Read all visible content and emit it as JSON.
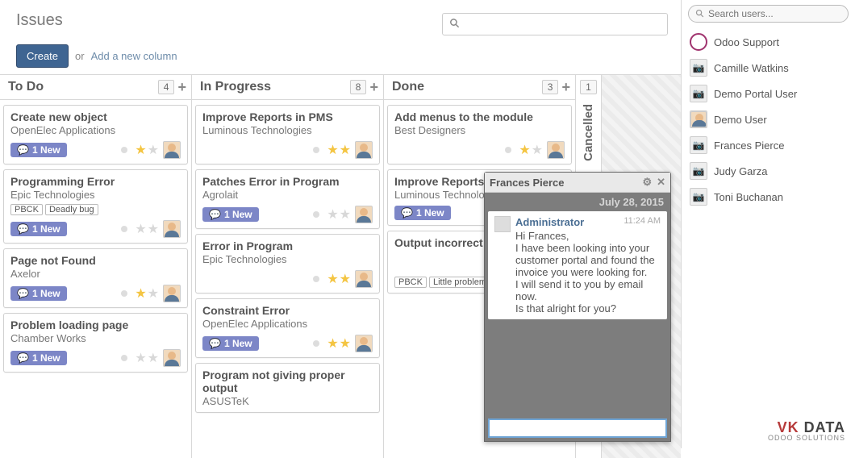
{
  "header": {
    "title": "Issues",
    "create_label": "Create",
    "or_label": "or",
    "new_column_link": "Add a new column"
  },
  "search_placeholder": "",
  "columns": {
    "todo": {
      "title": "To Do",
      "count": "4"
    },
    "inprogress": {
      "title": "In Progress",
      "count": "8"
    },
    "done": {
      "title": "Done",
      "count": "3"
    },
    "cancelled": {
      "title": "Cancelled",
      "count": "1"
    }
  },
  "pill_text": "1 New",
  "cards": {
    "todo": [
      {
        "title": "Create new object",
        "sub": "OpenElec Applications",
        "tags": [],
        "stars": 1
      },
      {
        "title": "Programming Error",
        "sub": "Epic Technologies",
        "tags": [
          "PBCK",
          "Deadly bug"
        ],
        "stars": 0
      },
      {
        "title": "Page not Found",
        "sub": "Axelor",
        "tags": [],
        "stars": 1
      },
      {
        "title": "Problem loading page",
        "sub": "Chamber Works",
        "tags": [],
        "stars": 0
      }
    ],
    "inprogress": [
      {
        "title": "Improve Reports in PMS",
        "sub": "Luminous Technologies",
        "tags": [],
        "stars": 2
      },
      {
        "title": "Patches Error in Program",
        "sub": "Agrolait",
        "tags": [],
        "stars": 0
      },
      {
        "title": "Error in Program",
        "sub": "Epic Technologies",
        "tags": [],
        "stars": 2
      },
      {
        "title": "Constraint Error",
        "sub": "OpenElec Applications",
        "tags": [],
        "stars": 2
      },
      {
        "title": "Program not giving proper output",
        "sub": "ASUSTeK",
        "tags": [],
        "stars": 0
      }
    ],
    "done": [
      {
        "title": "Add menus to the module",
        "sub": "Best Designers",
        "tags": [],
        "stars": 1
      },
      {
        "title": "Improve Reports in HRMS",
        "sub": "Luminous Technologies",
        "tags": [],
        "stars": 0
      },
      {
        "title": "Output incorrect",
        "sub": "",
        "tags": [
          "PBCK",
          "Little problem"
        ],
        "stars": 0
      }
    ]
  },
  "chat": {
    "title": "Frances Pierce",
    "date": "July 28, 2015",
    "author": "Administrator",
    "time": "11:24 AM",
    "lines": [
      "Hi Frances,",
      "I have been looking into your customer portal and found the invoice you were looking for.",
      "I will send it to you by email now.",
      "Is that alright for you?"
    ]
  },
  "user_search_placeholder": "Search users...",
  "users": [
    "Odoo Support",
    "Camille Watkins",
    "Demo Portal User",
    "Demo User",
    "Frances Pierce",
    "Judy Garza",
    "Toni Buchanan"
  ],
  "brand": {
    "line1a": "VK",
    "line1b": " DATA",
    "line2": "ODOO SOLUTIONS"
  }
}
